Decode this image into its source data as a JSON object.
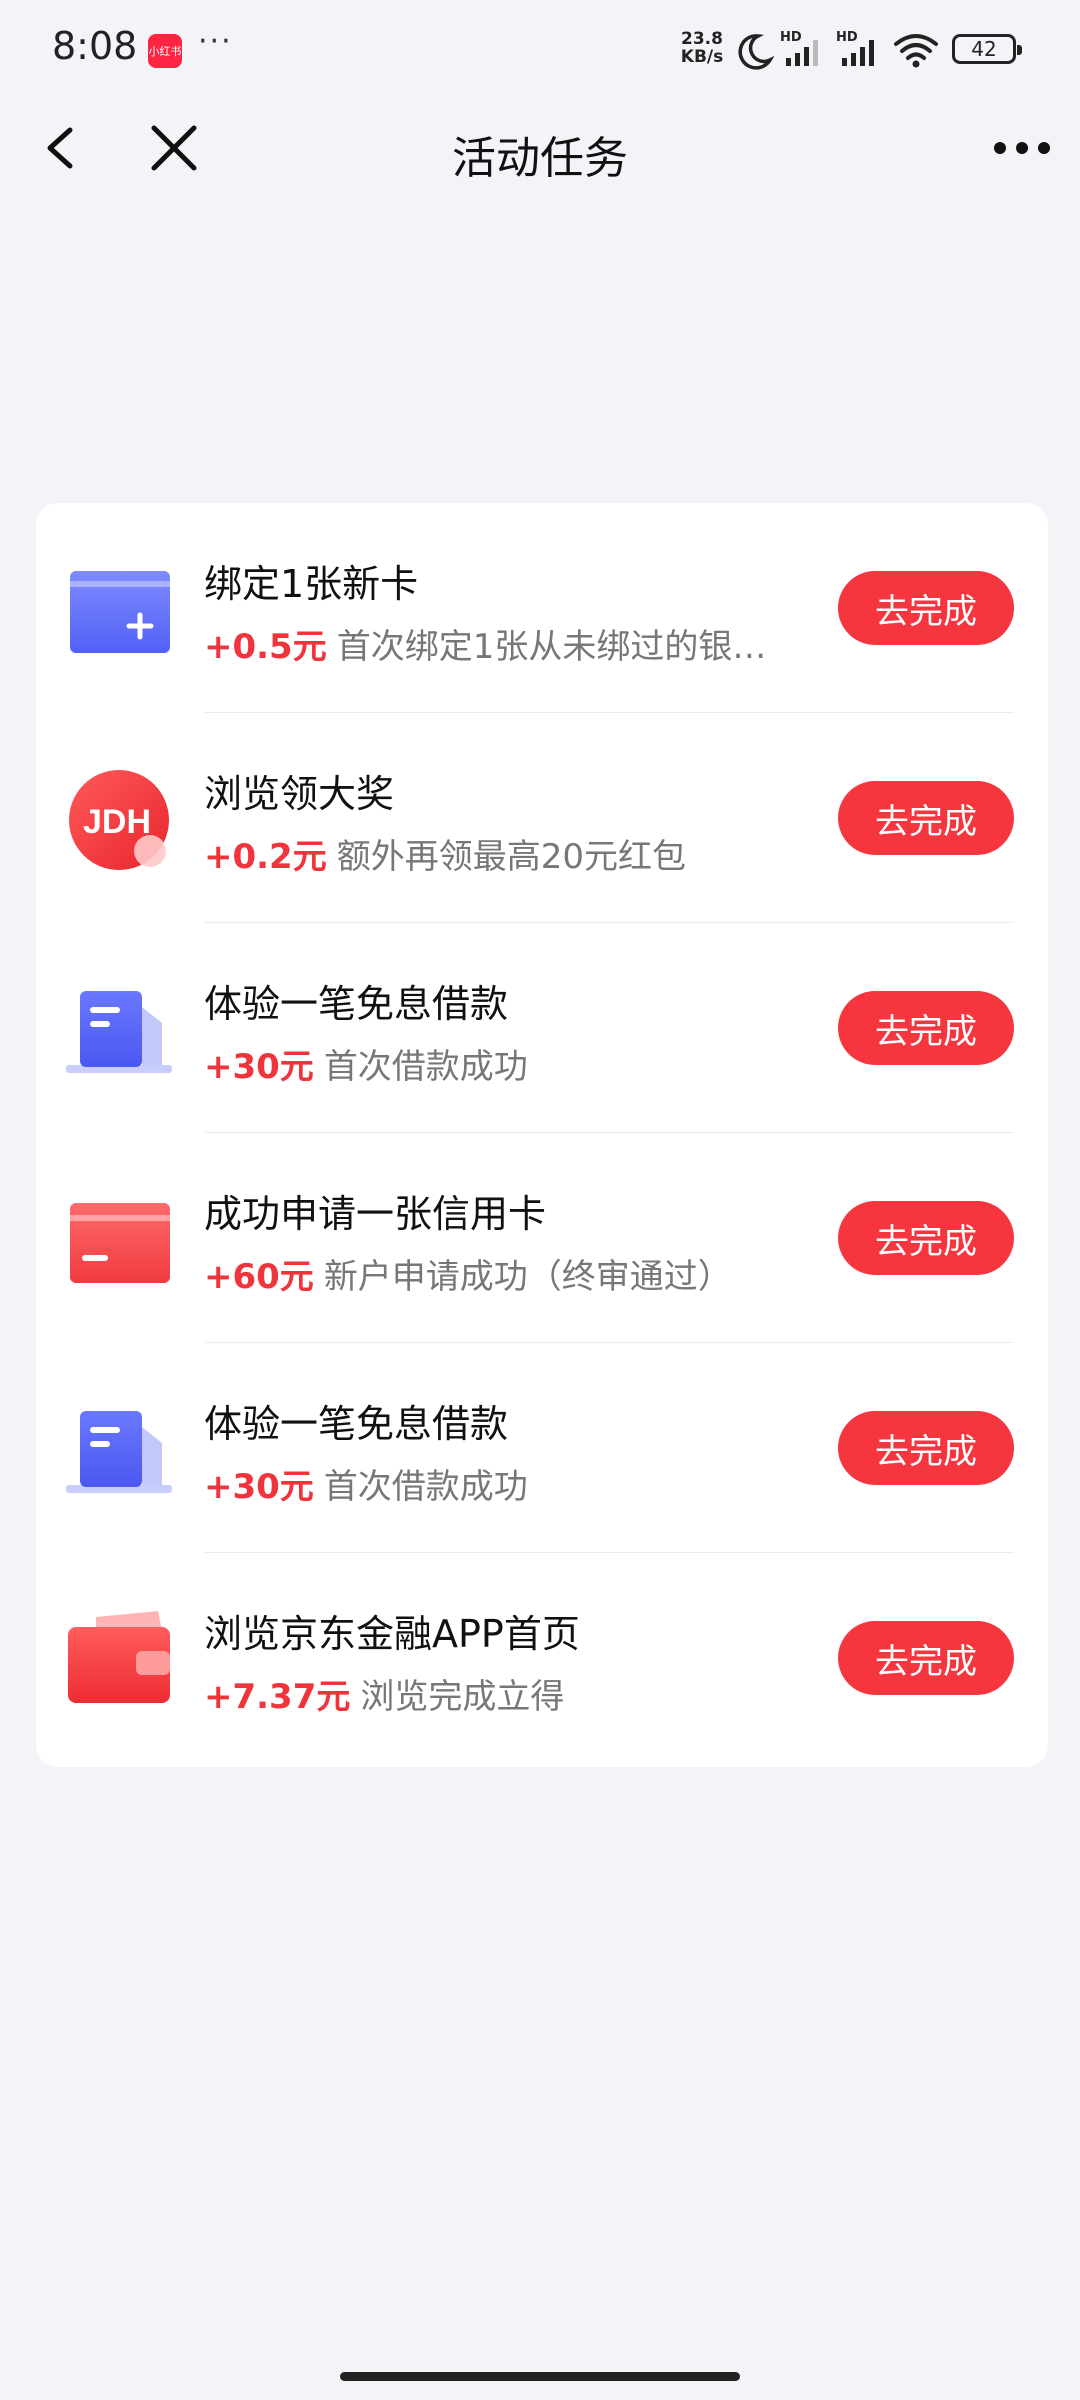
{
  "status_bar": {
    "time": "8:08",
    "app_badge": "小红书",
    "overflow_dots": "···",
    "net_speed": "23.8",
    "net_unit": "KB/s",
    "sim1": "HD",
    "sim2": "HD",
    "battery": "42"
  },
  "nav": {
    "title": "活动任务"
  },
  "tasks": [
    {
      "title": "绑定1张新卡",
      "amount": "+0.5元",
      "desc": "首次绑定1张从未绑过的银…",
      "button": "去完成",
      "icon": "bank-card-add-icon"
    },
    {
      "title": "浏览领大奖",
      "amount": "+0.2元",
      "desc": "额外再领最高20元红包",
      "button": "去完成",
      "icon": "jdh-logo-icon"
    },
    {
      "title": "体验一笔免息借款",
      "amount": "+30元",
      "desc": "首次借款成功",
      "button": "去完成",
      "icon": "document-loan-icon"
    },
    {
      "title": "成功申请一张信用卡",
      "amount": "+60元",
      "desc": "新户申请成功（终审通过）",
      "button": "去完成",
      "icon": "credit-card-icon"
    },
    {
      "title": "体验一笔免息借款",
      "amount": "+30元",
      "desc": "首次借款成功",
      "button": "去完成",
      "icon": "document-loan-icon"
    },
    {
      "title": "浏览京东金融APP首页",
      "amount": "+7.37元",
      "desc": "浏览完成立得",
      "button": "去完成",
      "icon": "wallet-icon"
    }
  ]
}
